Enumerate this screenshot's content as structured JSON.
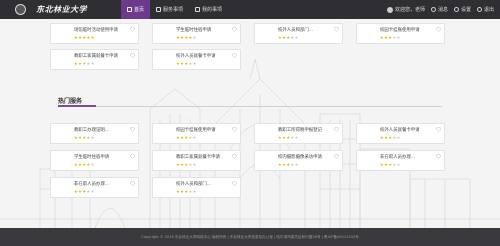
{
  "header": {
    "logo_text": "东北林业大学",
    "nav": [
      {
        "label": "首页",
        "icon": "home-icon",
        "active": true
      },
      {
        "label": "服务事项",
        "icon": "grid-icon",
        "active": false
      },
      {
        "label": "我的事项",
        "icon": "doc-icon",
        "active": false
      }
    ],
    "user": {
      "name": "欢迎您，老师",
      "msg_label": "消息",
      "settings_label": "设置",
      "logout_label": "退出"
    }
  },
  "favorites": [
    {
      "title": "场馆临时活动使用申请",
      "stars": 5
    },
    {
      "title": "学生临时住宿申请",
      "stars": 4
    },
    {
      "title": "校外人员和部门...",
      "stars": 3
    },
    {
      "title": "校园卡挂账使用申请",
      "stars": 3
    },
    {
      "title": "教职工家属就餐卡申请",
      "stars": 3
    },
    {
      "title": "校外人员就餐卡申请",
      "stars": 3
    }
  ],
  "hot_section": {
    "title": "热门服务",
    "items": [
      {
        "title": "教职工办理证明...",
        "stars": 3
      },
      {
        "title": "校园卡挂账使用申请",
        "stars": 3
      },
      {
        "title": "教职工所得税申报登记",
        "stars": 3
      },
      {
        "title": "校外人员就餐卡申请",
        "stars": 3
      },
      {
        "title": "学生临时住宿申请",
        "stars": 4
      },
      {
        "title": "教职工家属就餐卡申请",
        "stars": 3
      },
      {
        "title": "校内摄影摄像采访申请",
        "stars": 3
      },
      {
        "title": "非在职人员办理...",
        "stars": 3
      },
      {
        "title": "非在职人员办理...",
        "stars": 3
      },
      {
        "title": "校外人员和部门...",
        "stars": 3
      }
    ]
  },
  "footer": {
    "text": "Copyright © 2016  东北林业大学网络中心  版权所有  |  东北林业大学信息化办公室  |  哈尔滨市香坊区和兴路26号  |  黑ICP备05012345号"
  },
  "colors": {
    "accent": "#6b3a8e",
    "topbar": "#2f2f33",
    "star_on": "#f0b400",
    "star_off": "#c8c8c8"
  }
}
